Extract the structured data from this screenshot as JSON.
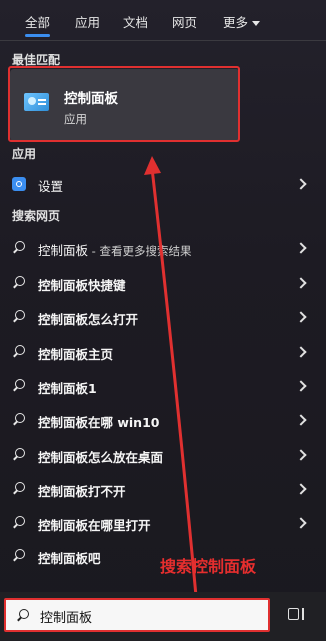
{
  "tabs": [
    {
      "label": "全部",
      "active": true
    },
    {
      "label": "应用",
      "active": false
    },
    {
      "label": "文档",
      "active": false
    },
    {
      "label": "网页",
      "active": false
    },
    {
      "label": "更多",
      "active": false
    }
  ],
  "best_match": {
    "section_label": "最佳匹配",
    "title": "控制面板",
    "subtitle": "应用",
    "icon": "control-panel-icon"
  },
  "apps": {
    "section_label": "应用",
    "items": [
      {
        "label": "设置",
        "icon": "gear-icon"
      }
    ]
  },
  "web": {
    "section_label": "搜索网页",
    "items": [
      {
        "label": "控制面板",
        "suffix": " - 查看更多搜索结果"
      },
      {
        "label": "控制面板快捷键",
        "suffix": ""
      },
      {
        "label": "控制面板怎么打开",
        "suffix": ""
      },
      {
        "label": "控制面板主页",
        "suffix": ""
      },
      {
        "label": "控制面板1",
        "suffix": ""
      },
      {
        "label": "控制面板在哪 win10",
        "suffix": ""
      },
      {
        "label": "控制面板怎么放在桌面",
        "suffix": ""
      },
      {
        "label": "控制面板打不开",
        "suffix": ""
      },
      {
        "label": "控制面板在哪里打开",
        "suffix": ""
      },
      {
        "label": "控制面板吧",
        "suffix": ""
      }
    ]
  },
  "annotation": {
    "text": "搜索控制面板",
    "color": "#e62e2e"
  },
  "search": {
    "value": "控制面板"
  },
  "colors": {
    "accent": "#3b8ef0",
    "highlight_box": "#e03030"
  }
}
